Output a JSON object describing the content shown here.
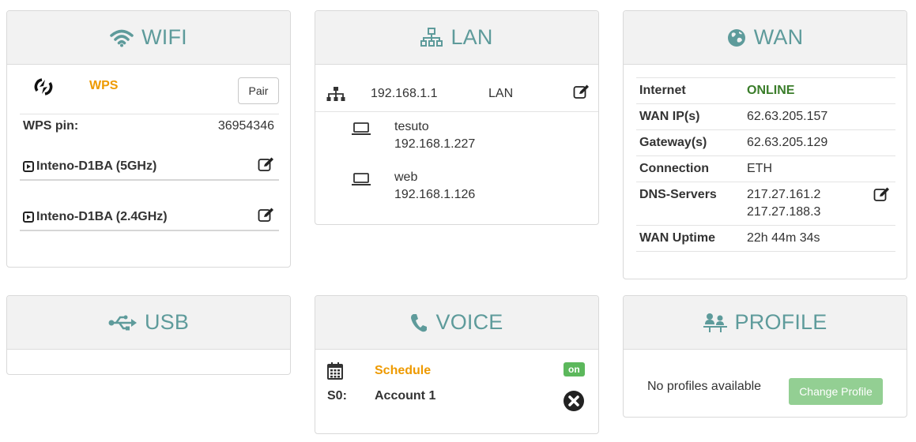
{
  "wifi": {
    "title": "WIFI",
    "wps_label": "WPS",
    "pair_button": "Pair",
    "wps_pin_label": "WPS pin:",
    "wps_pin_value": "36954346",
    "networks": [
      {
        "name": "Inteno-D1BA (5GHz)"
      },
      {
        "name": "Inteno-D1BA (2.4GHz)"
      }
    ]
  },
  "lan": {
    "title": "LAN",
    "ip": "192.168.1.1",
    "interface": "LAN",
    "clients": [
      {
        "name": "tesuto",
        "ip": "192.168.1.227"
      },
      {
        "name": "web",
        "ip": "192.168.1.126"
      }
    ]
  },
  "wan": {
    "title": "WAN",
    "rows": [
      {
        "label": "Internet",
        "value": "ONLINE"
      },
      {
        "label": "WAN IP(s)",
        "value": "62.63.205.157"
      },
      {
        "label": "Gateway(s)",
        "value": "62.63.205.129"
      },
      {
        "label": "Connection",
        "value": "ETH"
      },
      {
        "label": "DNS-Servers",
        "value": "217.27.161.2",
        "value2": "217.27.188.3"
      },
      {
        "label": "WAN Uptime",
        "value": "22h 44m 34s"
      }
    ]
  },
  "usb": {
    "title": "USB"
  },
  "voice": {
    "title": "VOICE",
    "schedule_label": "Schedule",
    "schedule_status": "on",
    "line_label": "S0:",
    "account": "Account 1"
  },
  "profile": {
    "title": "PROFILE",
    "empty_text": "No profiles available",
    "change_button": "Change Profile"
  },
  "colors": {
    "header_text": "#5e9b9b",
    "accent_orange": "#ee9a00",
    "online_green": "#3a7d2a",
    "badge_green": "#5cb85c",
    "button_green": "#93cf93"
  }
}
